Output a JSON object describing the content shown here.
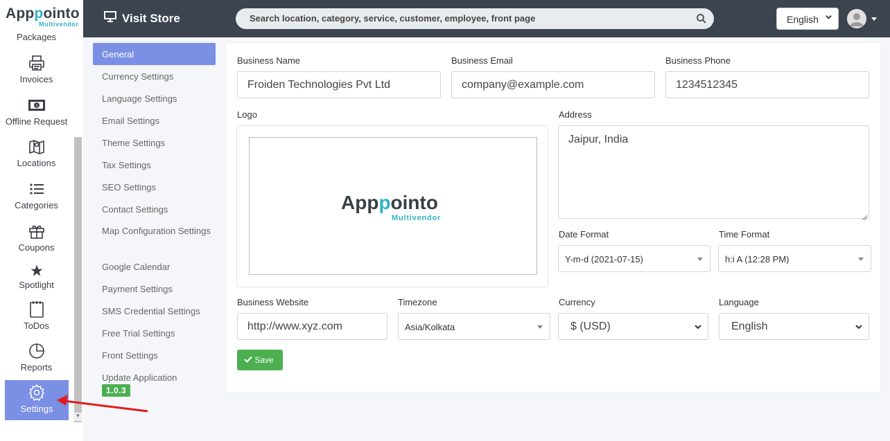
{
  "brand": {
    "main_a": "App",
    "main_b": "p",
    "main_c": "ointo",
    "sub": "Multivendor"
  },
  "sidebar": {
    "items": [
      {
        "label": "Packages",
        "icon": "package-icon"
      },
      {
        "label": "Invoices",
        "icon": "printer-icon"
      },
      {
        "label": "Offline Request",
        "icon": "cash-icon"
      },
      {
        "label": "Locations",
        "icon": "map-icon"
      },
      {
        "label": "Categories",
        "icon": "list-icon"
      },
      {
        "label": "Coupons",
        "icon": "gift-icon"
      },
      {
        "label": "Spotlight",
        "icon": "star-icon"
      },
      {
        "label": "ToDos",
        "icon": "notepad-icon"
      },
      {
        "label": "Reports",
        "icon": "pie-chart-icon"
      },
      {
        "label": "Settings",
        "icon": "gear-icon"
      }
    ]
  },
  "topbar": {
    "visit_store": "Visit Store",
    "search_placeholder": "Search location, category, service, customer, employee, front page",
    "language": "English"
  },
  "settings_nav": {
    "items": [
      "General",
      "Currency Settings",
      "Language Settings",
      "Email Settings",
      "Theme Settings",
      "Tax Settings",
      "SEO Settings",
      "Contact Settings",
      "Map Configuration Settings",
      "Google Calendar",
      "Payment Settings",
      "SMS Credential Settings",
      "Free Trial Settings",
      "Front Settings",
      "Update Application"
    ],
    "version": "1.0.3"
  },
  "form": {
    "business_name_label": "Business Name",
    "business_name": "Froiden Technologies Pvt Ltd",
    "business_email_label": "Business Email",
    "business_email": "company@example.com",
    "business_phone_label": "Business Phone",
    "business_phone": "1234512345",
    "logo_label": "Logo",
    "logo": {
      "main_a": "App",
      "main_b": "p",
      "main_c": "ointo",
      "sub": "Multivendor"
    },
    "address_label": "Address",
    "address": "Jaipur, India",
    "date_format_label": "Date Format",
    "date_format": "Y-m-d (2021-07-15)",
    "time_format_label": "Time Format",
    "time_format": "h:i A (12:28 PM)",
    "website_label": "Business Website",
    "website": "http://www.xyz.com",
    "timezone_label": "Timezone",
    "timezone": "Asia/Kolkata",
    "currency_label": "Currency",
    "currency": "$ (USD)",
    "language_label": "Language",
    "language": "English",
    "save_label": "Save"
  },
  "colors": {
    "accent": "#7b8fe4",
    "topbar": "#3c4450",
    "success": "#4caf50",
    "brand": "#2fb3c8"
  }
}
